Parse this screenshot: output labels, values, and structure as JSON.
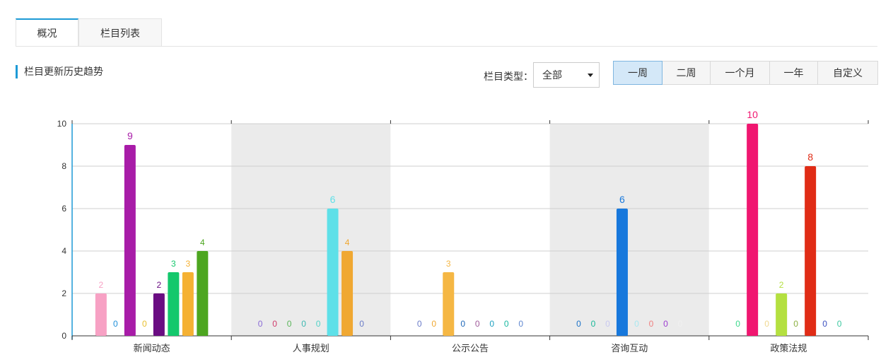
{
  "tabs": [
    {
      "label": "概况",
      "active": true
    },
    {
      "label": "栏目列表",
      "active": false
    }
  ],
  "section": {
    "title": "栏目更新历史趋势"
  },
  "filter": {
    "type_label": "栏目类型：",
    "type_value": "全部"
  },
  "range": [
    {
      "label": "一周",
      "active": true
    },
    {
      "label": "二周",
      "active": false
    },
    {
      "label": "一个月",
      "active": false
    },
    {
      "label": "一年",
      "active": false
    },
    {
      "label": "自定义",
      "active": false
    }
  ],
  "chart_data": {
    "type": "bar",
    "categories": [
      "新闻动态",
      "人事规划",
      "公示公告",
      "咨询互动",
      "政策法规"
    ],
    "ylim": [
      0,
      10
    ],
    "yticks": [
      0,
      2,
      4,
      6,
      8,
      10
    ],
    "grid": true,
    "band_shading": [
      "#ffffff",
      "#ebebeb"
    ],
    "series_colors": [
      "#f7a1c4",
      "#1f8fd9",
      "#a81ca8",
      "#e8c030",
      "#6a0d82",
      "#14c86c",
      "#f5b133",
      "#4da620",
      "#8a6ad6",
      "#d03c6c",
      "#5ab55a",
      "#3cb8b0",
      "#52d2c8",
      "#5ee0e8",
      "#f0a832",
      "#6a7cc8",
      "#f5b744",
      "#1f68b9",
      "#a05a9a",
      "#1ea0c0",
      "#18b8a0",
      "#6088d0",
      "#1a72c8",
      "#18b898",
      "#c8c8f0",
      "#1778dc",
      "#a8e8f0",
      "#f08080",
      "#9c3cd0",
      "#f0f0f0",
      "#f01670",
      "#3cd88c",
      "#f0d890",
      "#b4e040",
      "#8cb040",
      "#e02c16",
      "#3c50c0",
      "#3cc8a0"
    ],
    "groups": [
      {
        "category": "新闻动态",
        "values": [
          2,
          0,
          9,
          0,
          2,
          3,
          3,
          4
        ],
        "color_idx": [
          0,
          1,
          2,
          3,
          4,
          5,
          6,
          7
        ]
      },
      {
        "category": "人事规划",
        "values": [
          0,
          0,
          0,
          0,
          0,
          6,
          4,
          0
        ],
        "color_idx": [
          8,
          9,
          10,
          11,
          12,
          13,
          14,
          15
        ]
      },
      {
        "category": "公示公告",
        "values": [
          0,
          0,
          3,
          0,
          0,
          0,
          0,
          0
        ],
        "color_idx": [
          15,
          14,
          16,
          17,
          18,
          19,
          20,
          21
        ]
      },
      {
        "category": "咨询互动",
        "values": [
          0,
          0,
          0,
          6,
          0,
          0,
          0,
          0
        ],
        "color_idx": [
          22,
          23,
          24,
          25,
          26,
          27,
          28,
          29
        ]
      },
      {
        "category": "政策法规",
        "values": [
          0,
          10,
          0,
          2,
          0,
          8,
          0,
          0
        ],
        "color_idx": [
          31,
          30,
          32,
          33,
          34,
          35,
          36,
          37
        ]
      }
    ]
  }
}
